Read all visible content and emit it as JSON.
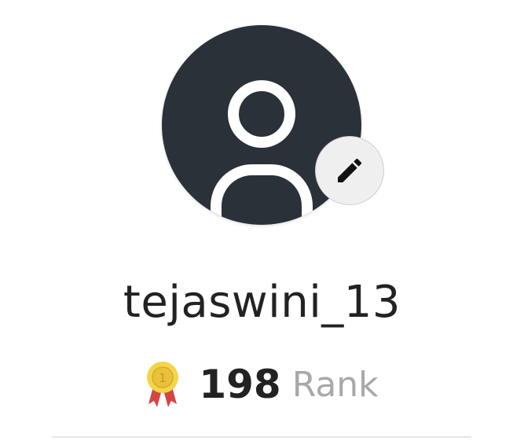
{
  "profile": {
    "username": "tejaswini_13",
    "rank_value": "198",
    "rank_label": "Rank"
  },
  "icons": {
    "avatar": "user-placeholder-icon",
    "edit": "pencil-icon",
    "medal": "medal-icon"
  },
  "colors": {
    "avatar_bg": "#2b3138",
    "edit_bg": "#efefef",
    "rank_label": "#a8a8a8"
  }
}
